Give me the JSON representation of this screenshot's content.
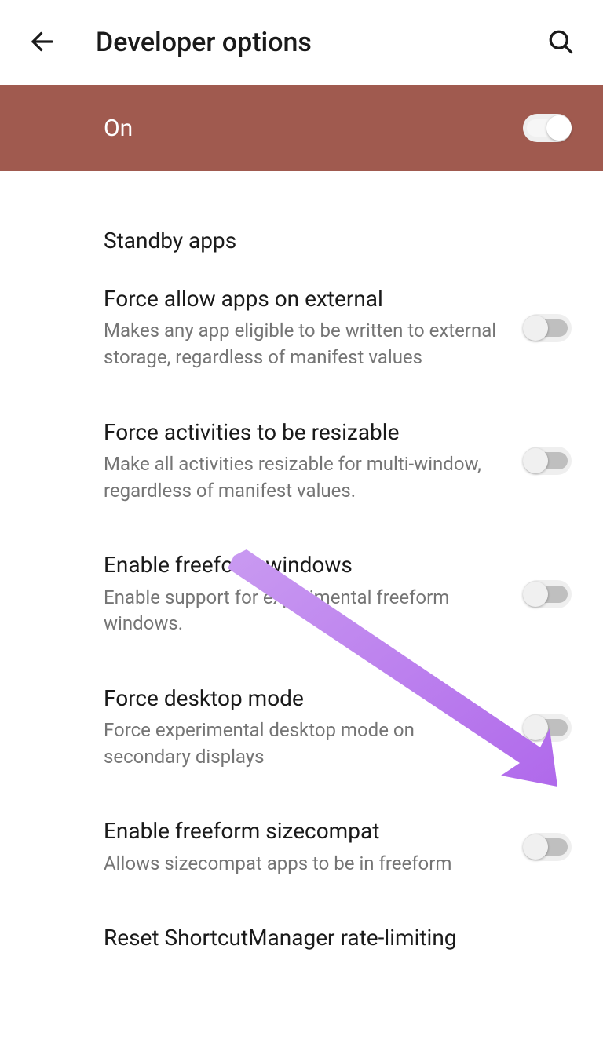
{
  "header": {
    "title": "Developer options"
  },
  "banner": {
    "status": "On",
    "toggle_on": true
  },
  "section": {
    "title": "Standby apps"
  },
  "settings": [
    {
      "title": "Force allow apps on external",
      "desc": "Makes any app eligible to be written to external storage, regardless of manifest values",
      "on": false
    },
    {
      "title": "Force activities to be resizable",
      "desc": "Make all activities resizable for multi-window, regardless of manifest values.",
      "on": false
    },
    {
      "title": "Enable freeform windows",
      "desc": "Enable support for experimental freeform windows.",
      "on": false
    },
    {
      "title": "Force desktop mode",
      "desc": "Force experimental desktop mode on secondary displays",
      "on": false
    },
    {
      "title": "Enable freeform sizecompat",
      "desc": "Allows sizecompat apps to be in freeform",
      "on": false
    }
  ],
  "footer": {
    "title": "Reset ShortcutManager rate-limiting"
  },
  "annotation": {
    "arrow_color": "#b97aed"
  }
}
